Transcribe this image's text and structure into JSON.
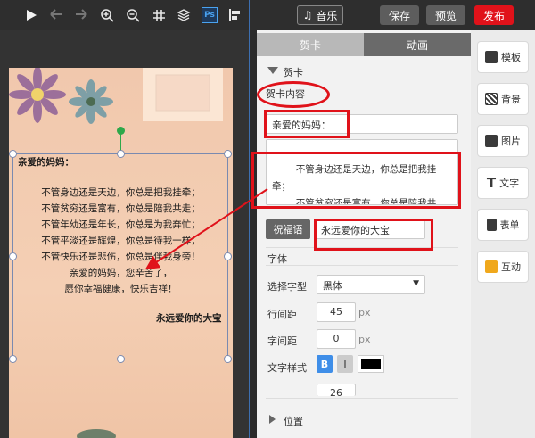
{
  "toolbar": {
    "music_label": "音乐",
    "save_label": "保存",
    "preview_label": "预览",
    "publish_label": "发布",
    "music_icon": "♫",
    "ps_label": "Ps"
  },
  "tabs": [
    {
      "label": "贺卡",
      "active": true
    },
    {
      "label": "动画",
      "active": false
    }
  ],
  "panel": {
    "section_title": "贺卡",
    "content_label": "贺卡内容",
    "salutation_value": "亲爱的妈妈：",
    "body_value": "        不管身边还是天边，你总是把我挂牵；\n        不管贫穷还是富有，你总是陪我共",
    "greeting_button": "祝福语",
    "signature_value": "永远爱你的大宝",
    "font_section": "字体",
    "font_face_label": "选择字型",
    "font_face_value": "黑体",
    "line_spacing_label": "行间距",
    "line_spacing_value": "45",
    "letter_spacing_label": "字间距",
    "letter_spacing_value": "0",
    "unit": "px",
    "text_style_label": "文字样式",
    "bold_label": "B",
    "italic_label": "I",
    "font_size_value": "26",
    "position_label": "位置",
    "text_color": "#000000"
  },
  "sidebar": [
    {
      "label": "模板",
      "icon": "template-icon"
    },
    {
      "label": "背景",
      "icon": "background-icon"
    },
    {
      "label": "图片",
      "icon": "image-icon"
    },
    {
      "label": "文字",
      "icon": "text-icon"
    },
    {
      "label": "表单",
      "icon": "form-icon"
    },
    {
      "label": "互动",
      "icon": "interact-icon"
    }
  ],
  "card": {
    "salutation": "亲爱的妈妈：",
    "lines": [
      "不管身边还是天边，你总是把我挂牵；",
      "不管贫穷还是富有，你总是陪我共走；",
      "不管年幼还是年长，你总是为我奔忙；",
      "不管平淡还是辉煌，你总是待我一样；",
      "不管快乐还是悲伤，你总是伴我身旁！",
      "亲爱的妈妈，您辛苦了，",
      "愿你幸福健康，快乐吉祥！"
    ],
    "signature": "永远爱你的大宝"
  },
  "colors": {
    "accent_red": "#e0121a",
    "publish_bg": "#e0121a",
    "tab_active_bg": "#b8b8b8",
    "tab_inactive_bg": "#6a6a6a",
    "bold_btn": "#3f8ee8"
  }
}
